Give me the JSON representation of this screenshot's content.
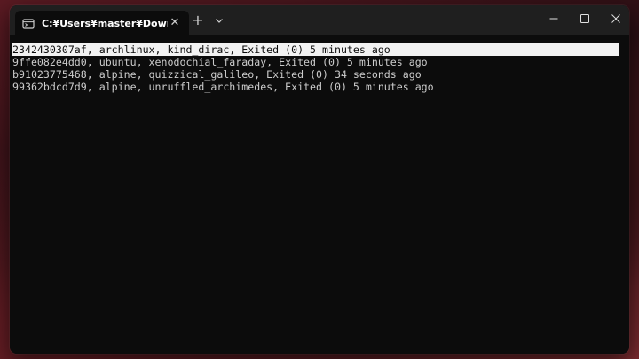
{
  "tab": {
    "title": "C:¥Users¥master¥Downloads¥",
    "icon": "terminal-icon",
    "close_glyph": "✕"
  },
  "titlebar": {
    "new_tab_glyph": "+",
    "dropdown_icon": "chevron-down-icon"
  },
  "window_controls": {
    "minimize_icon": "minimize-icon",
    "maximize_icon": "maximize-icon",
    "close_icon": "close-icon"
  },
  "terminal": {
    "lines": [
      "2342430307af, archlinux, kind_dirac, Exited (0) 5 minutes ago",
      "9ffe082e4dd0, ubuntu, xenodochial_faraday, Exited (0) 5 minutes ago",
      "b91023775468, alpine, quizzical_galileo, Exited (0) 34 seconds ago",
      "99362bdcd7d9, alpine, unruffled_archimedes, Exited (0) 5 minutes ago"
    ],
    "selected_index": 0
  },
  "colors": {
    "terminal_bg": "#0c0c0c",
    "terminal_fg": "#cccccc",
    "selection_bg": "#f2f2f2",
    "titlebar_bg": "#1f1f1f"
  }
}
